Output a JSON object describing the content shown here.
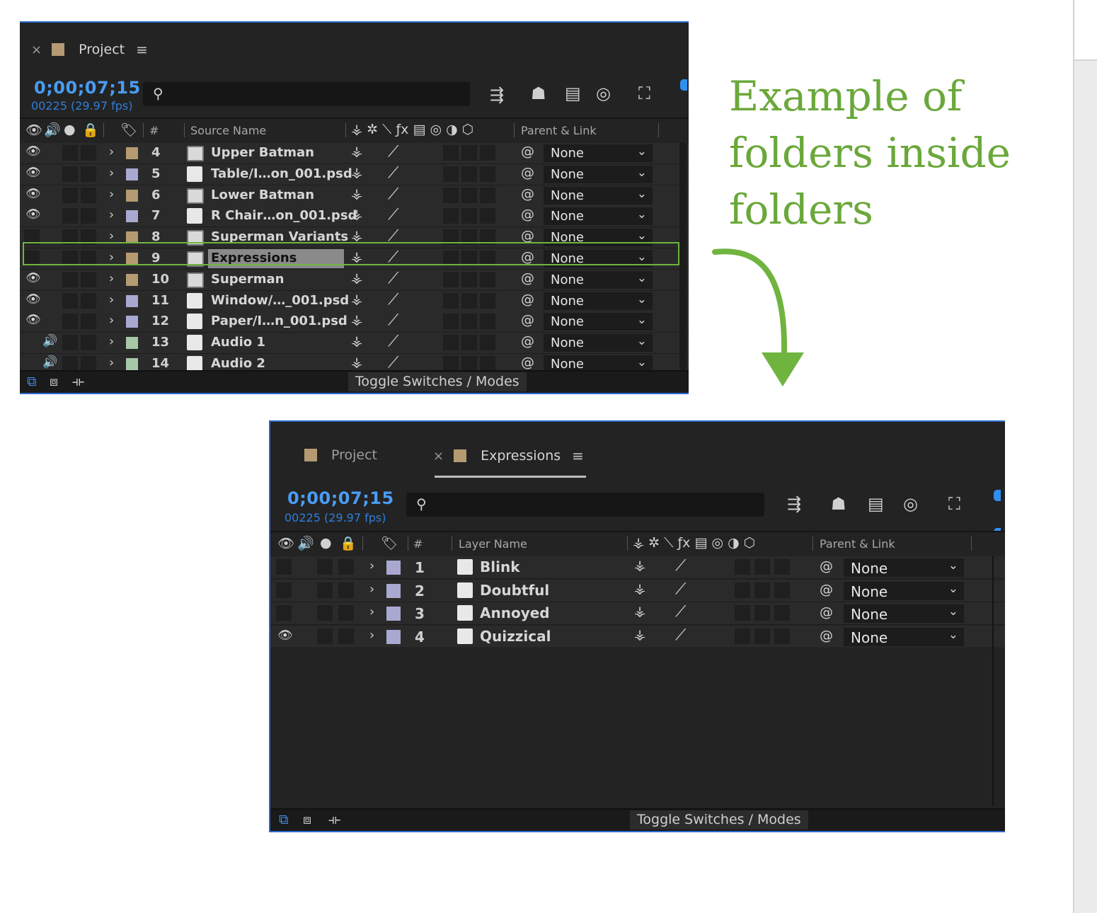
{
  "annotation": "Example of folders inside folders",
  "colors": {
    "accent_blue": "#2d6ad0",
    "timecode_blue": "#4a9cf3",
    "annotation_green": "#6aa83a",
    "folder_tan": "#b59a72",
    "psd_lavender": "#a8a8d0",
    "audio_green": "#a6c8a8"
  },
  "project_panel": {
    "tab_close": "×",
    "tab_label": "Project",
    "tab_menu": "≡",
    "timecode": "0;00;07;15",
    "fps": "00225 (29.97 fps)",
    "columns": {
      "hash": "#",
      "name": "Source Name",
      "parent": "Parent & Link"
    },
    "rows": [
      {
        "num": "4",
        "name": "Upper Batman",
        "parent": "None",
        "type": "comp",
        "color": "#b59a72",
        "eye": true,
        "audio": false
      },
      {
        "num": "5",
        "name": "Table/I…on_001.psd",
        "parent": "None",
        "type": "psd",
        "color": "#a8a8d0",
        "eye": true,
        "audio": false
      },
      {
        "num": "6",
        "name": "Lower Batman",
        "parent": "None",
        "type": "comp",
        "color": "#b59a72",
        "eye": true,
        "audio": false
      },
      {
        "num": "7",
        "name": "R Chair…on_001.psd",
        "parent": "None",
        "type": "psd",
        "color": "#a8a8d0",
        "eye": true,
        "audio": false
      },
      {
        "num": "8",
        "name": "Superman Variants",
        "parent": "None",
        "type": "comp",
        "color": "#b59a72",
        "eye": false,
        "audio": false
      },
      {
        "num": "9",
        "name": "Expressions",
        "parent": "None",
        "type": "comp",
        "color": "#b59a72",
        "eye": false,
        "audio": false,
        "highlight": true
      },
      {
        "num": "10",
        "name": "Superman",
        "parent": "None",
        "type": "comp",
        "color": "#b59a72",
        "eye": true,
        "audio": false
      },
      {
        "num": "11",
        "name": "Window/…_001.psd",
        "parent": "None",
        "type": "psd",
        "color": "#a8a8d0",
        "eye": true,
        "audio": false
      },
      {
        "num": "12",
        "name": "Paper/I…n_001.psd",
        "parent": "None",
        "type": "psd",
        "color": "#a8a8d0",
        "eye": true,
        "audio": false
      },
      {
        "num": "13",
        "name": "Audio 1",
        "parent": "None",
        "type": "audio",
        "color": "#a6c8a8",
        "eye": false,
        "audio": true
      },
      {
        "num": "14",
        "name": "Audio 2",
        "parent": "None",
        "type": "audio",
        "color": "#a6c8a8",
        "eye": false,
        "audio": true
      }
    ],
    "toggle_label": "Toggle Switches / Modes"
  },
  "expressions_panel": {
    "tab_project": "Project",
    "tab_close": "×",
    "tab_label": "Expressions",
    "tab_menu": "≡",
    "timecode": "0;00;07;15",
    "fps": "00225 (29.97 fps)",
    "columns": {
      "hash": "#",
      "name": "Layer Name",
      "parent": "Parent & Link"
    },
    "rows": [
      {
        "num": "1",
        "name": "Blink",
        "parent": "None",
        "eye": false
      },
      {
        "num": "2",
        "name": "Doubtful",
        "parent": "None",
        "eye": false
      },
      {
        "num": "3",
        "name": "Annoyed",
        "parent": "None",
        "eye": false
      },
      {
        "num": "4",
        "name": "Quizzical",
        "parent": "None",
        "eye": true
      }
    ],
    "toggle_label": "Toggle Switches / Modes"
  }
}
